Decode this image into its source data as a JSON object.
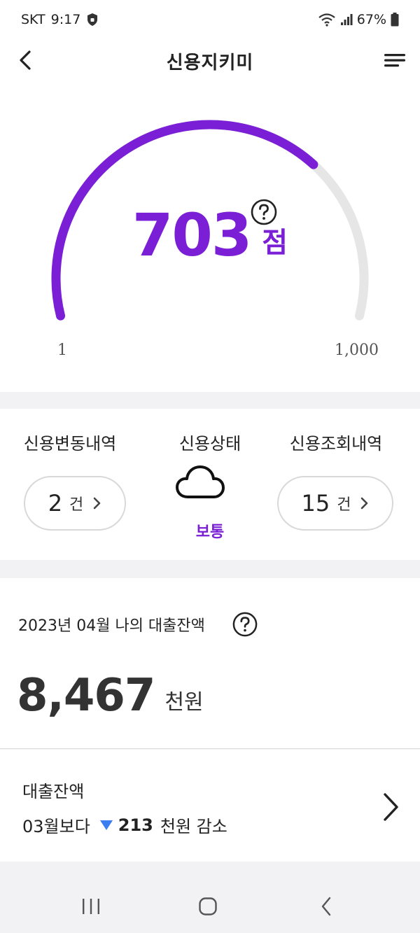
{
  "status_bar": {
    "carrier": "SKT",
    "time": "9:17",
    "battery": "67%",
    "icons": [
      "shield-icon",
      "wifi-icon",
      "signal-icon",
      "battery-icon"
    ]
  },
  "header": {
    "title": "신용지키미",
    "icons": [
      "back-arrow-icon",
      "menu-icon"
    ]
  },
  "score": {
    "value": "703",
    "unit": "점",
    "min_label": "1",
    "max_label": "1,000",
    "fill_fraction": 0.703,
    "accent_color": "#7a1fd6",
    "track_color": "#e6e6e6",
    "help_icon": "question-circle-icon"
  },
  "stats": {
    "change_history": {
      "title": "신용변동내역",
      "count": "2",
      "unit": "건"
    },
    "status": {
      "title": "신용상태",
      "icon": "cloud-icon",
      "label": "보통"
    },
    "inquiry_history": {
      "title": "신용조회내역",
      "count": "15",
      "unit": "건"
    }
  },
  "loan": {
    "title": "2023년 04월 나의 대출잔액",
    "amount": "8,467",
    "unit": "천원",
    "help_icon": "question-circle-icon"
  },
  "loan_change": {
    "title": "대출잔액",
    "compare_label": "03월보다",
    "direction_icon": "down-triangle-icon",
    "direction_color": "#3a7ef0",
    "value": "213",
    "suffix": "천원 감소"
  },
  "nav_bar": {
    "buttons": [
      "recents-icon",
      "home-icon",
      "back-icon"
    ]
  }
}
